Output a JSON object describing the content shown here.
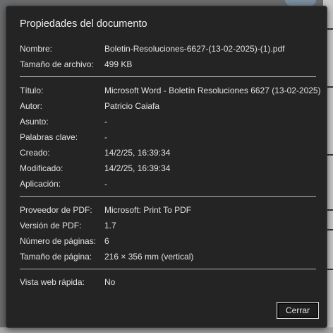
{
  "dialog": {
    "title": "Propiedades del documento",
    "file": [
      {
        "label": "Nombre:",
        "value": "Boletin-Resoluciones-6627-(13-02-2025)-(1).pdf"
      },
      {
        "label": "Tamaño de archivo:",
        "value": "499 KB"
      }
    ],
    "description": [
      {
        "label": "Título:",
        "value": "Microsoft Word - Boletín Resoluciones 6627 (13-02-2025)"
      },
      {
        "label": "Autor:",
        "value": "Patricio Caiafa"
      },
      {
        "label": "Asunto:",
        "value": "-"
      },
      {
        "label": "Palabras clave:",
        "value": "-"
      },
      {
        "label": "Creado:",
        "value": "14/2/25, 16:39:34"
      },
      {
        "label": "Modificado:",
        "value": "14/2/25, 16:39:34"
      },
      {
        "label": "Aplicación:",
        "value": "-"
      }
    ],
    "pdf": [
      {
        "label": "Proveedor de PDF:",
        "value": "Microsoft: Print To PDF"
      },
      {
        "label": "Versión de PDF:",
        "value": "1.7"
      },
      {
        "label": "Número de páginas:",
        "value": "6"
      },
      {
        "label": "Tamaño de página:",
        "value": "216 × 356 mm (vertical)"
      }
    ],
    "web": [
      {
        "label": "Vista web rápida:",
        "value": "No"
      }
    ],
    "close_label": "Cerrar"
  }
}
